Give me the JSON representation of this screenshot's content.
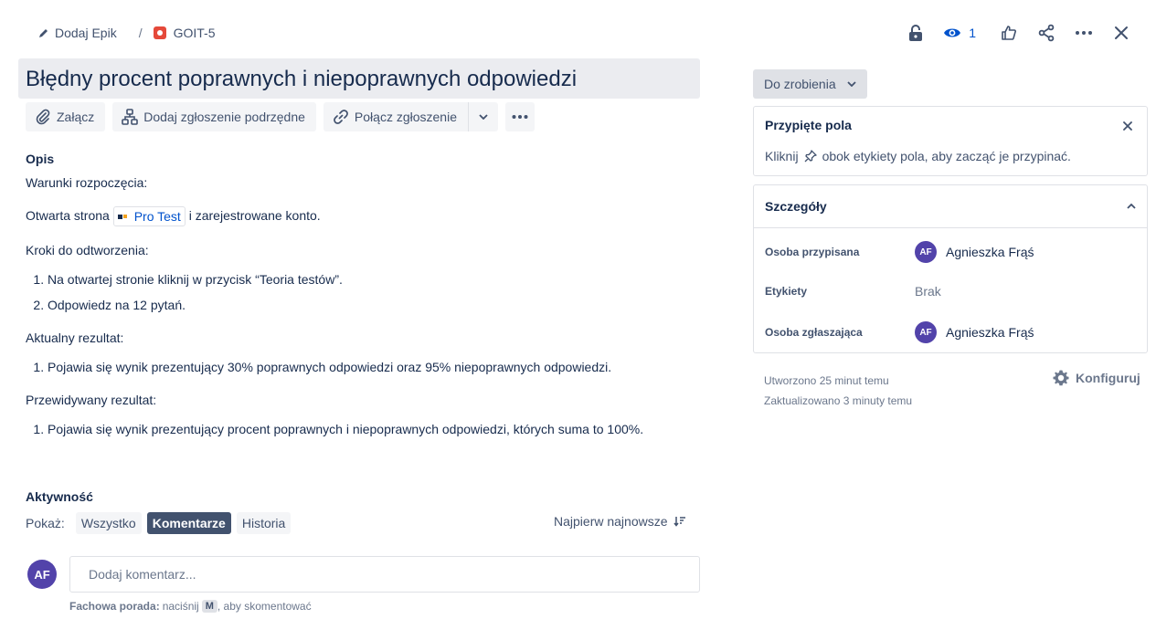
{
  "breadcrumb": {
    "epic_label": "Dodaj Epik",
    "separator": "/",
    "issue_key": "GOIT-5"
  },
  "header_actions": {
    "watch_count": "1",
    "icons": [
      "lock-icon",
      "eye-icon",
      "thumbs-up-icon",
      "share-icon",
      "more-icon",
      "close-icon"
    ]
  },
  "issue": {
    "title": "Błędny procent poprawnych i niepoprawnych odpowiedzi"
  },
  "toolbar": {
    "attach": "Załącz",
    "add_child": "Dodaj zgłoszenie podrzędne",
    "link_issue": "Połącz zgłoszenie"
  },
  "description": {
    "heading": "Opis",
    "preconditions_label": "Warunki rozpoczęcia:",
    "precondition_prefix": "Otwarta strona",
    "link_text": "Pro Test",
    "precondition_suffix": "i zarejestrowane konto.",
    "steps_label": "Kroki do odtworzenia:",
    "steps": [
      "Na otwartej stronie kliknij w przycisk “Teoria testów”.",
      "Odpowiedz na 12 pytań."
    ],
    "actual_label": "Aktualny rezultat:",
    "actual": [
      "Pojawia się wynik prezentujący 30% poprawnych odpowiedzi oraz 95% niepoprawnych odpowiedzi."
    ],
    "expected_label": "Przewidywany rezultat:",
    "expected": [
      "Pojawia się wynik prezentujący procent poprawnych i niepoprawnych odpowiedzi, których suma to 100%."
    ]
  },
  "activity": {
    "title": "Aktywność",
    "show_label": "Pokaż:",
    "filters": [
      "Wszystko",
      "Komentarze",
      "Historia"
    ],
    "active_filter": "Komentarze",
    "sort_label": "Najpierw najnowsze",
    "comment_placeholder": "Dodaj komentarz...",
    "user_initials": "AF",
    "pro_tip_bold": "Fachowa porada:",
    "pro_tip_pre": "naciśnij",
    "pro_tip_key": "M",
    "pro_tip_post": ", aby skomentować"
  },
  "sidebar": {
    "status": "Do zrobienia",
    "pinned": {
      "title": "Przypięte pola",
      "hint_pre": "Kliknij",
      "hint_post": "obok etykiety pola, aby zacząć je przypinać."
    },
    "details": {
      "title": "Szczegóły",
      "fields": [
        {
          "label": "Osoba przypisana",
          "value": "Agnieszka Frąś",
          "initials": "AF"
        },
        {
          "label": "Etykiety",
          "value": "Brak"
        },
        {
          "label": "Osoba zgłaszająca",
          "value": "Agnieszka Frąś",
          "initials": "AF"
        }
      ]
    },
    "created": "Utworzono 25 minut temu",
    "updated": "Zaktualizowano 3 minuty temu",
    "configure": "Konfiguruj"
  },
  "colors": {
    "accent": "#0052cc",
    "avatar": "#5243aa",
    "bug": "#e5493a"
  }
}
